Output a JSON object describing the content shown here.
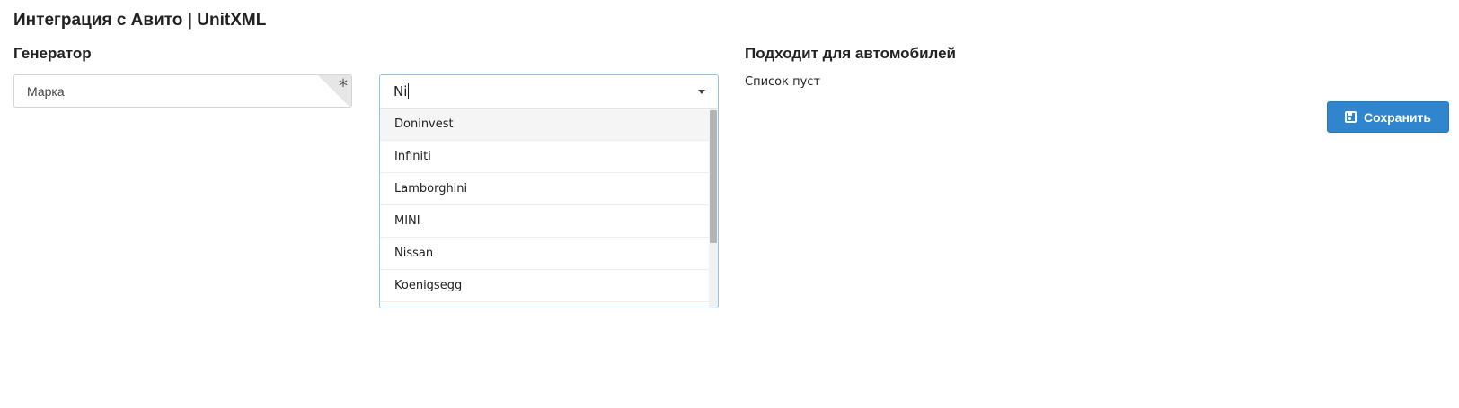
{
  "header": {
    "title": "Интеграция с Авито | UnitXML"
  },
  "generator": {
    "title": "Генератор",
    "brand_placeholder": "Марка",
    "required_mark": "*"
  },
  "combo": {
    "value": "Ni",
    "options": [
      "Doninvest",
      "Infiniti",
      "Lamborghini",
      "MINI",
      "Nissan",
      "Koenigsegg"
    ],
    "highlighted_index": 0
  },
  "fits": {
    "title": "Подходит для автомобилей",
    "empty_text": "Список пуст"
  },
  "actions": {
    "save_label": "Сохранить",
    "save_icon": "floppy-disk-icon",
    "accent_color": "#2f86cf"
  }
}
